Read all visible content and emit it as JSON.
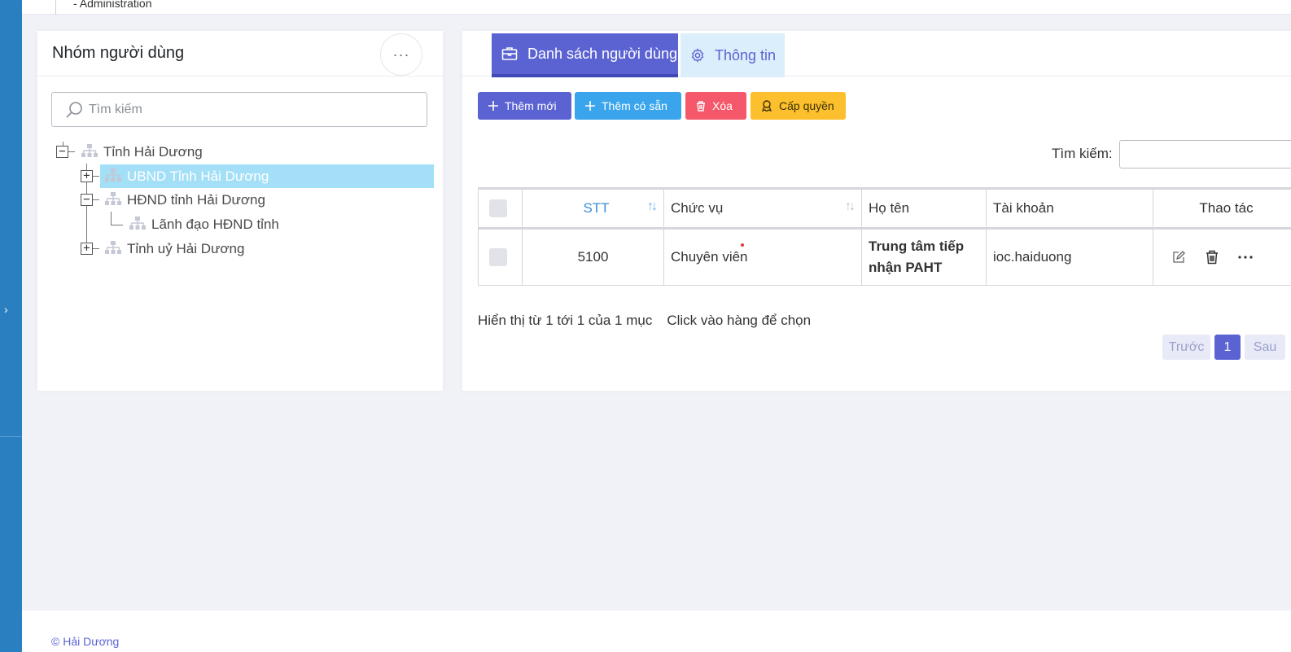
{
  "topbar": {
    "breadcrumb": "-  Administration"
  },
  "left_panel": {
    "title": "Nhóm người dùng",
    "more_label": "···",
    "search_placeholder": "Tìm kiếm",
    "tree": [
      {
        "label": "Tỉnh Hải Dương",
        "toggle": "−"
      },
      {
        "label": "UBND Tỉnh Hải Dương",
        "toggle": "+",
        "selected": true
      },
      {
        "label": "HĐND tỉnh Hải Dương",
        "toggle": "−"
      },
      {
        "label": "Lãnh đạo HĐND tỉnh"
      },
      {
        "label": "Tỉnh uỷ Hải Dương",
        "toggle": "+"
      }
    ]
  },
  "right_panel": {
    "tabs": [
      {
        "label": "Danh sách người dùng",
        "active": true
      },
      {
        "label": "Thông tin",
        "active": false
      }
    ],
    "toolbar": {
      "add": "Thêm mới",
      "add_existing": "Thêm có sẵn",
      "delete": "Xóa",
      "grant": "Cấp quyền"
    },
    "search_label": "Tìm kiếm:",
    "table": {
      "headers": {
        "stt": "STT",
        "position": "Chức vụ",
        "name": "Họ tên",
        "account": "Tài khoản",
        "actions": "Thao tác"
      },
      "rows": [
        {
          "stt": "5100",
          "position": "Chuyên viên",
          "name": "Trung tâm tiếp nhận PAHT",
          "account": "ioc.haiduong"
        }
      ]
    },
    "info": "Hiển thị từ 1 tới 1 của 1 mục",
    "hint": "Click vào hàng để chọn",
    "pagination": {
      "prev": "Trước",
      "current": "1",
      "next": "Sau"
    }
  },
  "footer": {
    "copyright": "© Hải Dương"
  },
  "colors": {
    "primary": "#5b63d3",
    "info": "#3aa5ec",
    "danger": "#f5586b",
    "warning": "#fcbf2d",
    "sidebar": "#2a7fc0",
    "selected": "#a4dff8"
  },
  "icons": [
    "chevron-right-icon",
    "more-horizontal-icon",
    "search-icon",
    "org-tree-icon",
    "briefcase-icon",
    "gear-icon",
    "plus-icon",
    "trash-icon",
    "award-icon",
    "sort-icon",
    "edit-icon"
  ]
}
